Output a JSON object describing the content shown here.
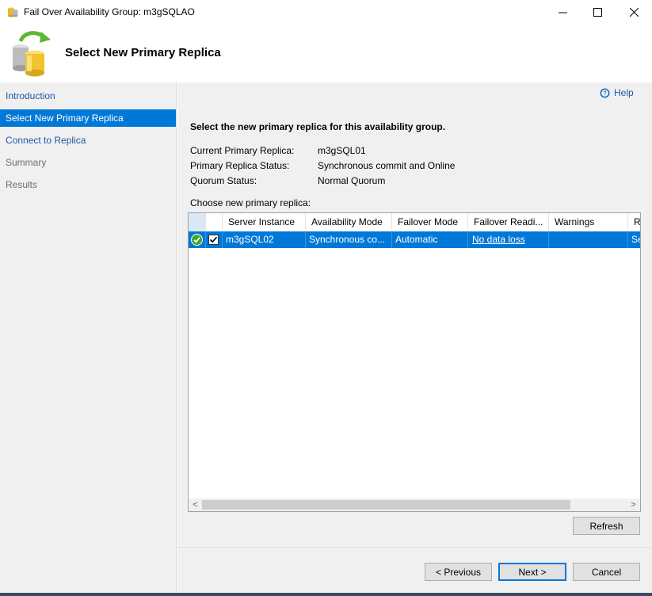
{
  "window": {
    "title": "Fail Over Availability Group: m3gSQLAO",
    "minimize_glyph": "—",
    "maximize_glyph": "☐",
    "close_glyph": "✕"
  },
  "header": {
    "title": "Select New Primary Replica"
  },
  "nav": {
    "items": [
      {
        "label": "Introduction",
        "state": "link"
      },
      {
        "label": "Select New Primary Replica",
        "state": "selected"
      },
      {
        "label": "Connect to Replica",
        "state": "link"
      },
      {
        "label": "Summary",
        "state": "disabled"
      },
      {
        "label": "Results",
        "state": "disabled"
      }
    ]
  },
  "help": {
    "label": "Help"
  },
  "page": {
    "instruction": "Select the new primary replica for this availability group.",
    "fields": [
      {
        "label": "Current Primary Replica:",
        "value": "m3gSQL01"
      },
      {
        "label": "Primary Replica Status:",
        "value": "Synchronous commit and Online"
      },
      {
        "label": "Quorum Status:",
        "value": "Normal Quorum"
      }
    ],
    "choose_label": "Choose new primary replica:"
  },
  "grid": {
    "columns": [
      "",
      "",
      "Server Instance",
      "Availability Mode",
      "Failover Mode",
      "Failover Readi...",
      "Warnings",
      "R"
    ],
    "rows": [
      {
        "server_instance": "m3gSQL02",
        "availability_mode": "Synchronous co...",
        "failover_mode": "Automatic",
        "failover_readiness": "No data loss",
        "warnings": "",
        "r": "Se",
        "checked": true
      }
    ],
    "scroll_left": "<",
    "scroll_right": ">"
  },
  "buttons": {
    "refresh": "Refresh",
    "previous": "< Previous",
    "next": "Next >",
    "cancel": "Cancel"
  },
  "colors": {
    "selection": "#0078d7",
    "link": "#1f57a5",
    "panel": "#f0f0f0"
  }
}
